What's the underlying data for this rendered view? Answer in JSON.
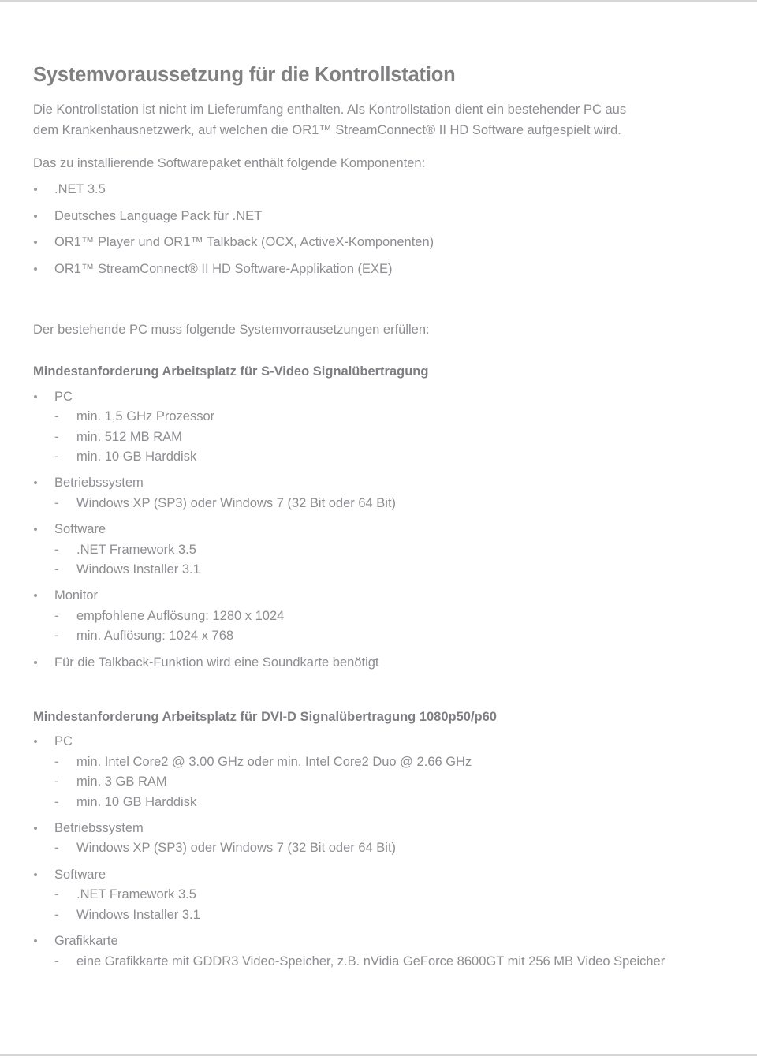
{
  "document": {
    "title": "Systemvoraussetzung für die Kontrollstation",
    "intro_paragraph": "Die Kontrollstation ist nicht im Lieferumfang enthalten. Als Kontrollstation dient ein bestehender PC aus dem Krankenhausnetzwerk, auf welchen die OR1™ StreamConnect® II HD Software aufgespielt wird.",
    "package_intro": "Das zu installierende Softwarepaket enthält folgende Komponenten:",
    "package_components": [
      ".NET 3.5",
      "Deutsches Language Pack für .NET",
      "OR1™ Player und OR1™ Talkback (OCX, ActiveX-Komponenten)",
      "OR1™ StreamConnect® II HD Software-Applikation (EXE)"
    ],
    "requirements_intro": "Der bestehende PC muss folgende Systemvorrausetzungen erfüllen:",
    "sections": [
      {
        "heading": "Mindestanforderung Arbeitsplatz für S-Video Signalübertragung",
        "groups": [
          {
            "label": "PC",
            "items": [
              "min. 1,5 GHz Prozessor",
              "min. 512 MB RAM",
              "min. 10 GB Harddisk"
            ]
          },
          {
            "label": "Betriebssystem",
            "items": [
              "Windows XP (SP3) oder Windows 7 (32 Bit oder 64 Bit)"
            ]
          },
          {
            "label": "Software",
            "items": [
              ".NET Framework 3.5",
              "Windows Installer 3.1"
            ]
          },
          {
            "label": "Monitor",
            "items": [
              "empfohlene Auflösung: 1280 x 1024",
              "min. Auflösung: 1024 x 768"
            ]
          },
          {
            "label": "Für die Talkback-Funktion wird eine Soundkarte benötigt",
            "items": []
          }
        ]
      },
      {
        "heading": "Mindestanforderung Arbeitsplatz für DVI-D Signalübertragung 1080p50/p60",
        "groups": [
          {
            "label": "PC",
            "items": [
              "min. Intel Core2 @ 3.00 GHz oder min. Intel Core2 Duo @ 2.66 GHz",
              "min. 3 GB RAM",
              "min. 10 GB Harddisk"
            ]
          },
          {
            "label": "Betriebssystem",
            "items": [
              "Windows XP (SP3) oder Windows 7 (32 Bit oder 64 Bit)"
            ]
          },
          {
            "label": "Software",
            "items": [
              ".NET Framework 3.5",
              "Windows Installer 3.1"
            ]
          },
          {
            "label": "Grafikkarte",
            "items": [
              "eine Grafikkarte mit GDDR3 Video-Speicher, z.B. nVidia GeForce 8600GT mit 256 MB Video Speicher"
            ]
          }
        ]
      }
    ]
  },
  "style": {
    "title_color": "#808083",
    "body_color": "#8d8d92",
    "heading_color": "#7d7d82",
    "rule_color": "#d6d6d8",
    "background": "#ffffff"
  }
}
